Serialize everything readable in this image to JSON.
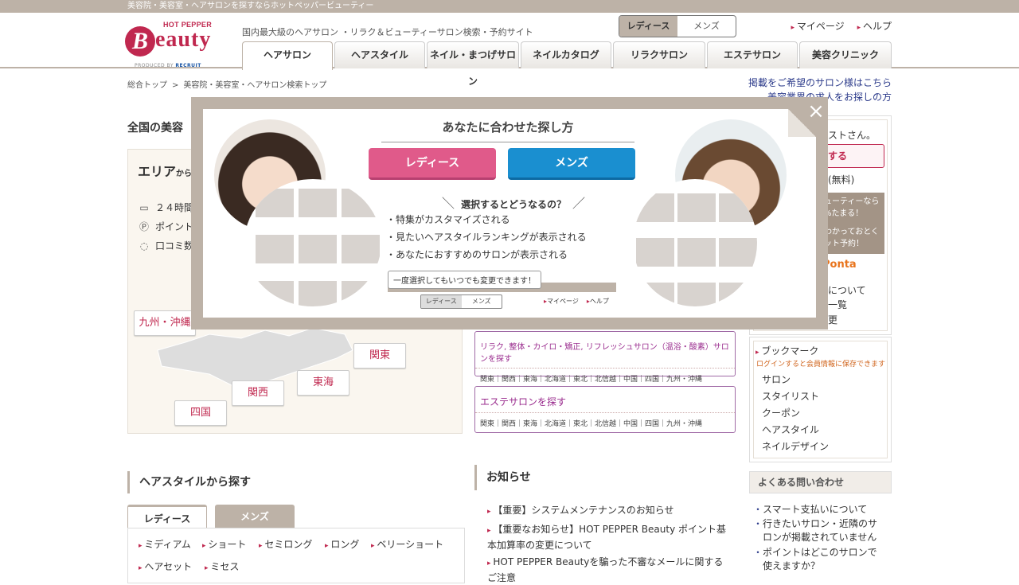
{
  "top_strip": "美容院・美容室・ヘアサロンを探すならホットペッパービューティー",
  "logo": {
    "hp": "HOT PEPPER",
    "b": "B",
    "eauty": "eauty",
    "produced_by": "PRODUCED BY",
    "recruit": "RECRUIT"
  },
  "header": {
    "tagline": "国内最大級のヘアサロン ・リラク＆ビューティーサロン検索・予約サイト",
    "gender": {
      "ladies": "レディース",
      "mens": "メンズ"
    },
    "links": {
      "mypage": "マイページ",
      "help": "ヘルプ"
    }
  },
  "nav": [
    "ヘアサロン",
    "ヘアスタイル",
    "ネイル・まつげサロン",
    "ネイルカタログ",
    "リラクサロン",
    "エステサロン",
    "美容クリニック"
  ],
  "breadcrumb": {
    "home": "総合トップ",
    "current": "美容院・美容室・ヘアサロン検索トップ",
    "sep": ">"
  },
  "right_links": {
    "listing": "掲載をご希望のサロン様はこちら",
    "jobs": "美容業界の求人をお探しの方"
  },
  "left": {
    "section_title": "全国の美容",
    "area_lead": "エリア",
    "area_lead_small": "から",
    "features": [
      {
        "icon": "monitor-icon",
        "text": "２４時間"
      },
      {
        "icon": "points-icon",
        "text": "ポイント"
      },
      {
        "icon": "comment-icon",
        "text": "口コミ数"
      }
    ],
    "area_buttons": {
      "kyushu": "九州・沖縄",
      "kanto": "関東",
      "tokai": "東海",
      "kansai": "関西",
      "shikoku": "四国"
    },
    "hairstyle_title": "ヘアスタイルから探す",
    "hairstyle_tabs": {
      "ladies": "レディース",
      "mens": "メンズ"
    },
    "hairstyle_items": [
      "ミディアム",
      "ショート",
      "セミロング",
      "ロング",
      "ベリーショート",
      "ヘアセット",
      "ミセス"
    ]
  },
  "middle": {
    "box1": {
      "title": "リラク, 整体・カイロ・矯正, リフレッシュサロン（温浴・酸素）サロンを探す",
      "regions": "関東｜関西｜東海｜北海道｜東北｜北信越｜中国｜四国｜九州・沖縄"
    },
    "box2": {
      "title": "エステサロンを探す",
      "regions": "関東｜関西｜東海｜北海道｜東北｜北信越｜中国｜四国｜九州・沖縄"
    },
    "notice_title": "お知らせ",
    "notices": [
      "【重要】システムメンテナンスのお知らせ",
      "【重要なお知らせ】HOT PEPPER Beauty ポイント基本加算率の変更について",
      "HOT PEPPER Beautyを騙った不審なメールに関するご注意"
    ]
  },
  "right": {
    "guest": "ストさん。",
    "register": "する",
    "free": "(無料)",
    "promo1": "ューティーなら",
    "promo2": "%たまる！",
    "promo3": "わかっておとく",
    "promo4": "ット予約！",
    "ponta": "Ponta",
    "link_about": "について",
    "link_list": "一覧",
    "link_change": "更",
    "bookmark_title": "ブックマーク",
    "bookmark_note": "ログインすると会員情報に保存できます",
    "bookmark_items": [
      "サロン",
      "スタイリスト",
      "クーポン",
      "ヘアスタイル",
      "ネイルデザイン"
    ],
    "faq_title": "よくある問い合わせ",
    "faq_items": [
      "スマート支払いについて",
      "行きたいサロン・近隣のサロンが掲載されていません",
      "ポイントはどこのサロンで使えますか？"
    ]
  },
  "modal": {
    "title": "あなたに合わせた探し方",
    "ladies_button": "レディース",
    "mens_button": "メンズ",
    "question": "選択するとどうなるの？",
    "slash_left": "＼",
    "slash_right": "／",
    "benefits": [
      "特集がカスタマイズされる",
      "見たいヘアスタイルランキングが表示される",
      "あなたにおすすめのサロンが表示される"
    ],
    "bubble": "一度選択してもいつでも変更できます！",
    "mini_ladies": "レディース",
    "mini_mens": "メンズ",
    "mini_mypage": "マイページ",
    "mini_help": "ヘルプ",
    "close": "×"
  }
}
